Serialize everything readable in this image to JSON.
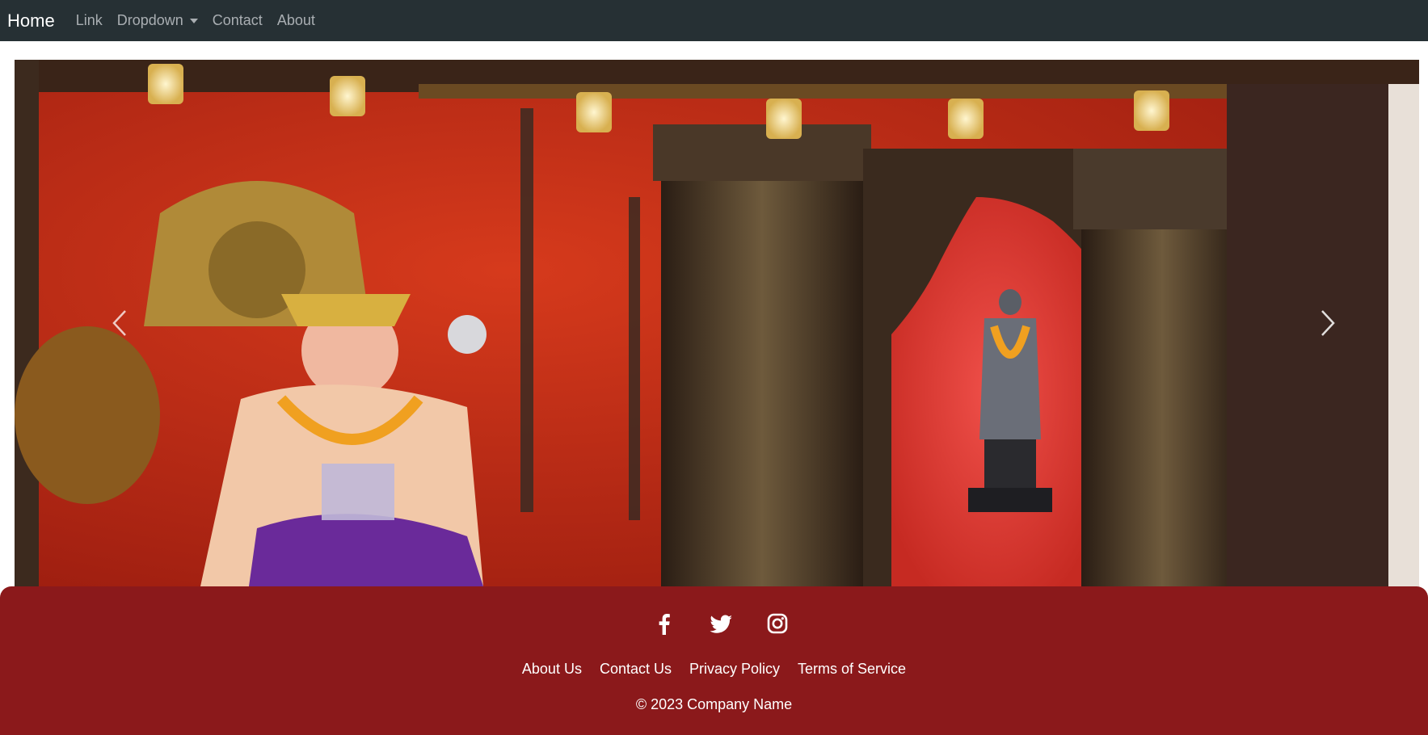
{
  "navbar": {
    "brand": "Home",
    "links": [
      {
        "label": "Link"
      },
      {
        "label": "Dropdown"
      },
      {
        "label": "Contact"
      },
      {
        "label": "About"
      }
    ]
  },
  "carousel": {
    "prev_icon": "chevron-left-icon",
    "next_icon": "chevron-right-icon"
  },
  "footer": {
    "social_icons": [
      "facebook-icon",
      "twitter-icon",
      "instagram-icon"
    ],
    "links": [
      "About Us",
      "Contact Us",
      "Privacy Policy",
      "Terms of Service"
    ],
    "copyright": "© 2023 Company Name",
    "background_color": "#8b191b"
  },
  "colors": {
    "navbar_bg": "#263034",
    "nav_link": "#a9aeb2"
  }
}
